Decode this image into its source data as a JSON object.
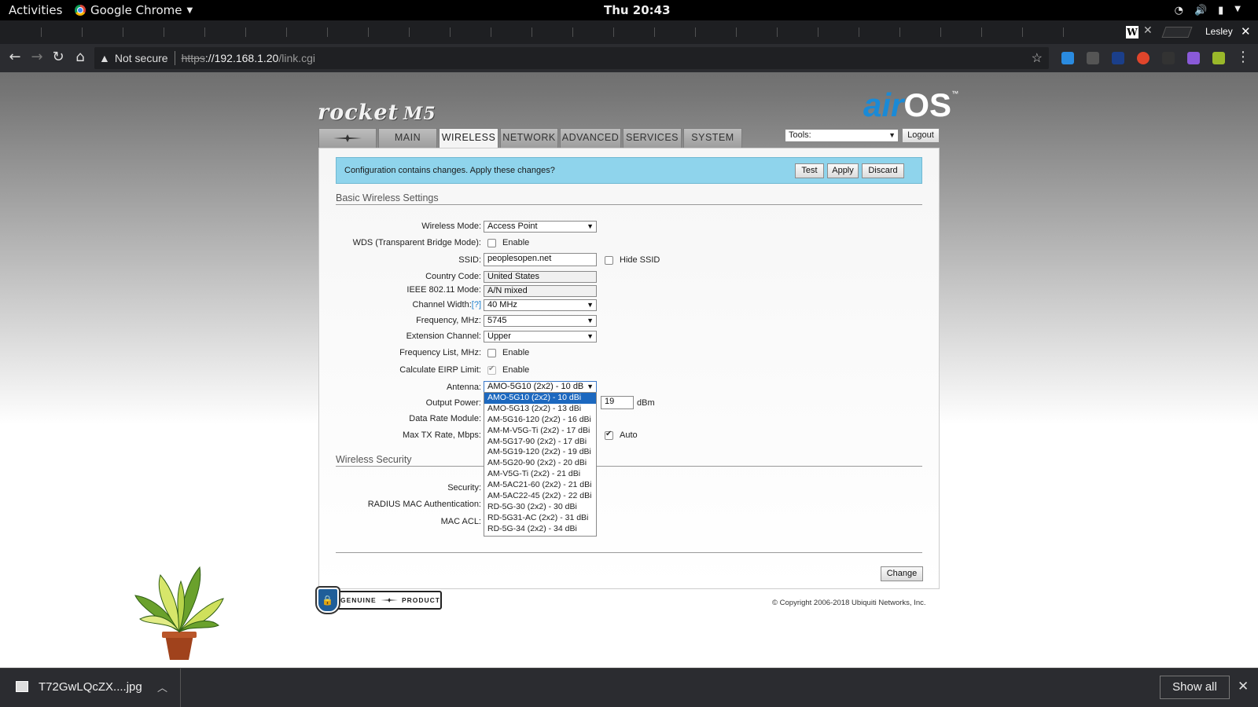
{
  "system_bar": {
    "activities": "Activities",
    "app_name": "Google Chrome",
    "clock": "Thu 20:43"
  },
  "browser": {
    "profile_name": "Lesley",
    "security_label": "Not secure",
    "url_scheme": "https",
    "url_host": "://192.168.1.20",
    "url_path": "/link.cgi"
  },
  "airos": {
    "brand_product": "rocket",
    "brand_model": "M5",
    "brand_air": "air",
    "brand_os": "OS",
    "brand_tm": "™",
    "tabs": [
      "MAIN",
      "WIRELESS",
      "NETWORK",
      "ADVANCED",
      "SERVICES",
      "SYSTEM"
    ],
    "active_tab": "WIRELESS",
    "tools_select": "Tools:",
    "logout_label": "Logout",
    "notice": {
      "message": "Configuration contains changes. Apply these changes?",
      "test": "Test",
      "apply": "Apply",
      "discard": "Discard"
    },
    "basic_title": "Basic Wireless Settings",
    "fields": {
      "wireless_mode": {
        "label": "Wireless Mode:",
        "value": "Access Point"
      },
      "wds": {
        "label": "WDS (Transparent Bridge Mode):",
        "option": "Enable"
      },
      "ssid": {
        "label": "SSID:",
        "value": "peoplesopen.net",
        "hide_label": "Hide SSID"
      },
      "country": {
        "label": "Country Code:",
        "value": "United States"
      },
      "ieee_mode": {
        "label": "IEEE 802.11 Mode:",
        "value": "A/N mixed"
      },
      "channel_width": {
        "label": "Channel Width:",
        "help": "[?]",
        "value": "40 MHz"
      },
      "frequency": {
        "label": "Frequency, MHz:",
        "value": "5745"
      },
      "ext_channel": {
        "label": "Extension Channel:",
        "value": "Upper"
      },
      "freq_list": {
        "label": "Frequency List, MHz:",
        "option": "Enable"
      },
      "eirp": {
        "label": "Calculate EIRP Limit:",
        "option": "Enable"
      },
      "antenna": {
        "label": "Antenna:",
        "value": "AMO-5G10 (2x2) - 10 dB"
      },
      "output_power": {
        "label": "Output Power:",
        "value": "19",
        "unit": "dBm"
      },
      "data_rate": {
        "label": "Data Rate Module:"
      },
      "max_tx": {
        "label": "Max TX Rate, Mbps:",
        "auto_label": "Auto"
      }
    },
    "antenna_options": [
      "AMO-5G10 (2x2) - 10 dBi",
      "AMO-5G13 (2x2) - 13 dBi",
      "AM-5G16-120 (2x2) - 16 dBi",
      "AM-M-V5G-Ti (2x2) - 17 dBi",
      "AM-5G17-90 (2x2) - 17 dBi",
      "AM-5G19-120 (2x2) - 19 dBi",
      "AM-5G20-90 (2x2) - 20 dBi",
      "AM-V5G-Ti (2x2) - 21 dBi",
      "AM-5AC21-60 (2x2) - 21 dBi",
      "AM-5AC22-45 (2x2) - 22 dBi",
      "RD-5G-30 (2x2) - 30 dBi",
      "RD-5G31-AC (2x2) - 31 dBi",
      "RD-5G-34 (2x2) - 34 dBi"
    ],
    "security_title": "Wireless Security",
    "security_fields": {
      "security": "Security:",
      "radius": "RADIUS MAC Authentication:",
      "mac_acl": "MAC ACL:"
    },
    "change_label": "Change",
    "genuine_text_left": "GENUINE",
    "genuine_text_right": "PRODUCT",
    "copyright": "© Copyright 2006-2018 Ubiquiti Networks, Inc."
  },
  "download_shelf": {
    "file_name": "T72GwLQcZX....jpg",
    "show_all": "Show all"
  },
  "colors": {
    "notice_bg": "#8fd4ec",
    "airos_blue": "#1a8ad6",
    "selected_option": "#1c68bf"
  }
}
